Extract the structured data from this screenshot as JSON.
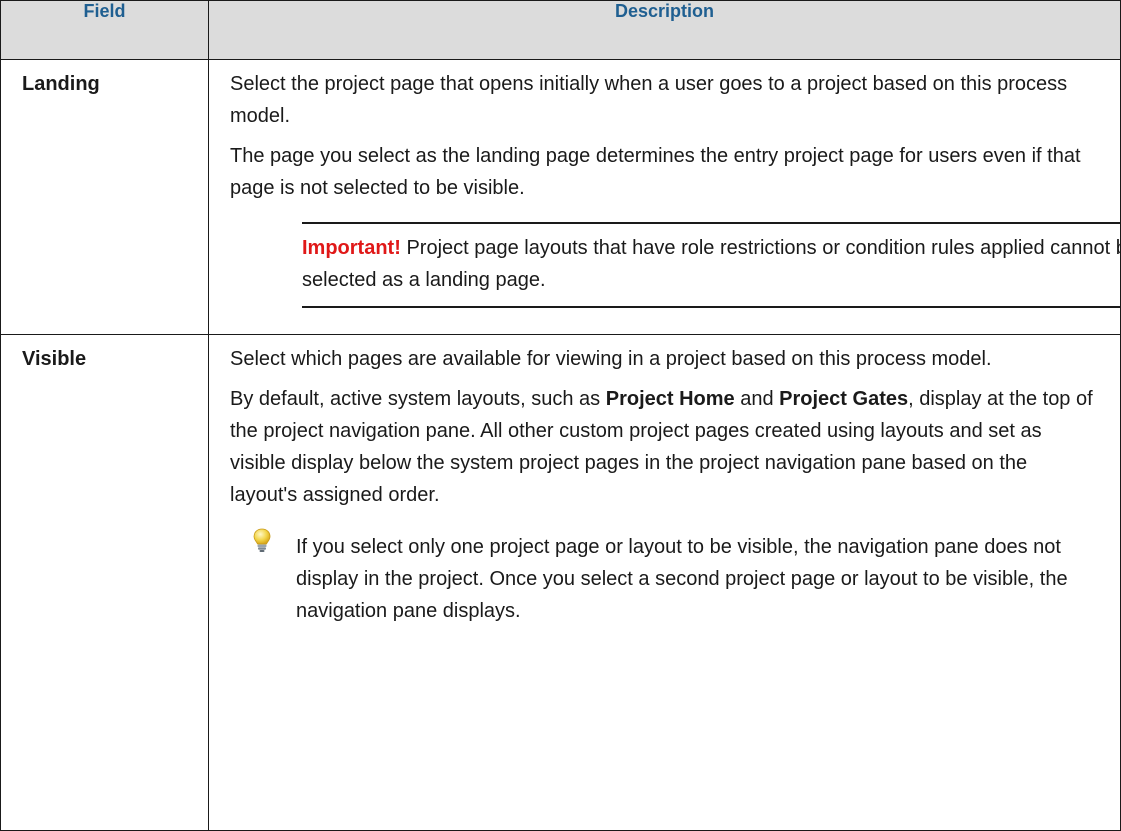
{
  "headers": {
    "field": "Field",
    "description": "Description"
  },
  "rows": [
    {
      "field": "Landing",
      "p1": "Select the project page that opens initially when a user goes to a project based on this process model.",
      "p2": "The page you select as the landing page determines the entry project page for users even if that page is not selected to be visible.",
      "important_label": "Important!",
      "important_text": " Project page layouts that have role restrictions or condition rules applied cannot be selected as a landing page."
    },
    {
      "field": "Visible",
      "p1": "Select which pages are available for viewing in a project based on this process model.",
      "p2_a": "By default, active system layouts, such as ",
      "p2_b": "Project Home",
      "p2_c": " and ",
      "p2_d": "Project Gates",
      "p2_e": ", display at the top of the project navigation pane. All other custom project pages created using layouts and set as visible display below the system project pages in the project navigation pane based on the layout's assigned order.",
      "tip_icon": "lightbulb-icon",
      "tip_text": "If you select only one project page or layout to be visible, the navigation pane does not display in the project. Once you select a second project page or layout to be visible, the navigation pane displays."
    }
  ],
  "colors": {
    "header_bg": "#dcdcdc",
    "header_text": "#1f5f91",
    "important": "#e01818",
    "bulb": "#f2d54a"
  }
}
